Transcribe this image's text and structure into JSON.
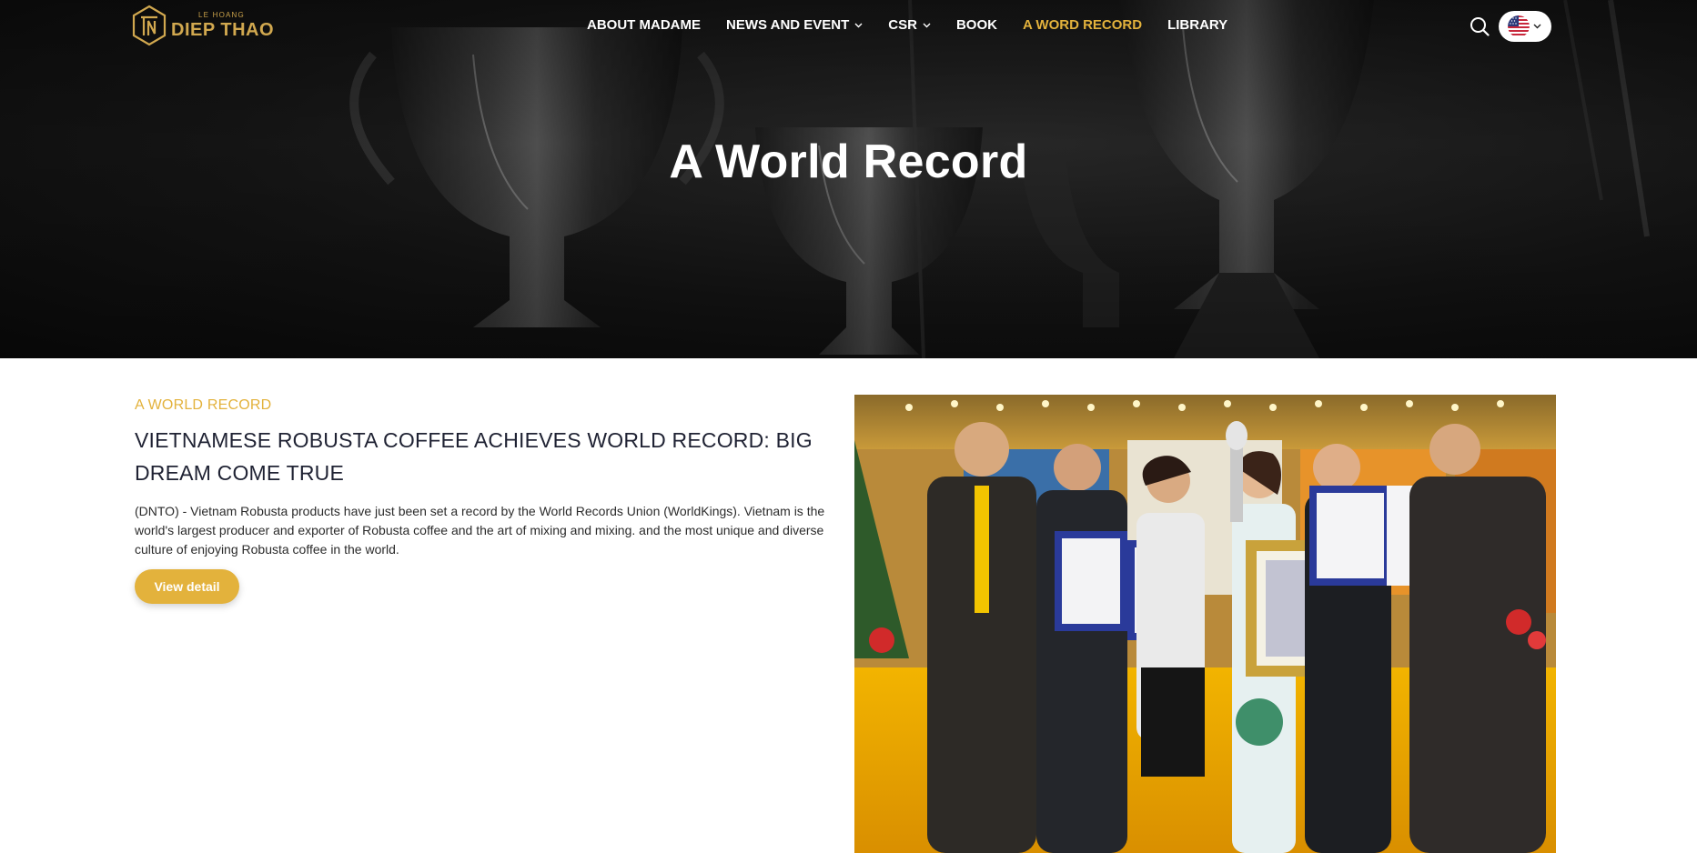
{
  "brand": {
    "small_text": "LE HOANG",
    "name": "DIEP THAO"
  },
  "nav": {
    "items": [
      {
        "label": "ABOUT MADAME",
        "has_dropdown": false,
        "active": false
      },
      {
        "label": "NEWS AND EVENT",
        "has_dropdown": true,
        "active": false
      },
      {
        "label": "CSR",
        "has_dropdown": true,
        "active": false
      },
      {
        "label": "BOOK",
        "has_dropdown": false,
        "active": false
      },
      {
        "label": "A WORD RECORD",
        "has_dropdown": false,
        "active": true
      },
      {
        "label": "LIBRARY",
        "has_dropdown": false,
        "active": false
      }
    ]
  },
  "hero": {
    "title": "A World Record"
  },
  "article": {
    "category": "A WORLD RECORD",
    "title": "VIETNAMESE ROBUSTA COFFEE ACHIEVES WORLD RECORD: BIG DREAM COME TRUE",
    "excerpt": "(DNTO) - Vietnam Robusta products have just been set a record by the World Records Union (WorldKings). Vietnam is the world's largest producer and exporter of Robusta coffee and the art of mixing and mixing. and the most unique and diverse culture of enjoying Robusta coffee in the world.",
    "button_label": "View detail"
  },
  "icons": {
    "search": "search-icon",
    "language": "us-flag-icon",
    "dropdown": "chevron-down-icon"
  },
  "colors": {
    "accent": "#e3b23c",
    "logo_gold": "#d1a84f",
    "heading": "#1f2233",
    "hero_bg": "#161616"
  }
}
